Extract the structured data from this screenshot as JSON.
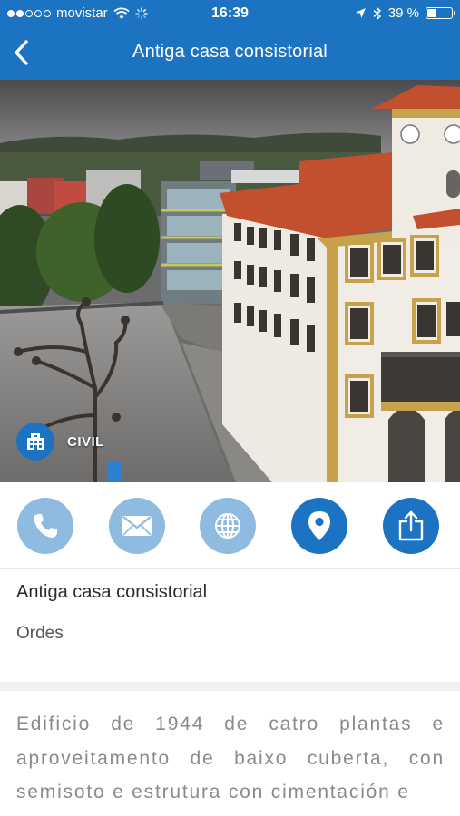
{
  "status_bar": {
    "carrier": "movistar",
    "time": "16:39",
    "battery": "39 %",
    "battery_level": 0.39
  },
  "nav": {
    "title": "Antiga casa consistorial",
    "back_icon": "chevron-left-icon"
  },
  "hero": {
    "category_icon": "building-icon",
    "category": "CIVIL"
  },
  "actions": [
    {
      "name": "call-button",
      "icon": "phone-icon",
      "state": "disabled"
    },
    {
      "name": "email-button",
      "icon": "envelope-icon",
      "state": "disabled"
    },
    {
      "name": "website-button",
      "icon": "globe-icon",
      "state": "disabled"
    },
    {
      "name": "location-button",
      "icon": "map-pin-icon",
      "state": "enabled"
    },
    {
      "name": "share-button",
      "icon": "share-icon",
      "state": "enabled"
    }
  ],
  "info": {
    "name": "Antiga casa consistorial",
    "town": "Ordes"
  },
  "description": "Edificio de 1944 de catro plantas e aproveitamento de baixo cuberta, con semisoto e estrutura con cimentación e",
  "colors": {
    "primary": "#1b73c2",
    "disabled": "#8fbbe0"
  }
}
